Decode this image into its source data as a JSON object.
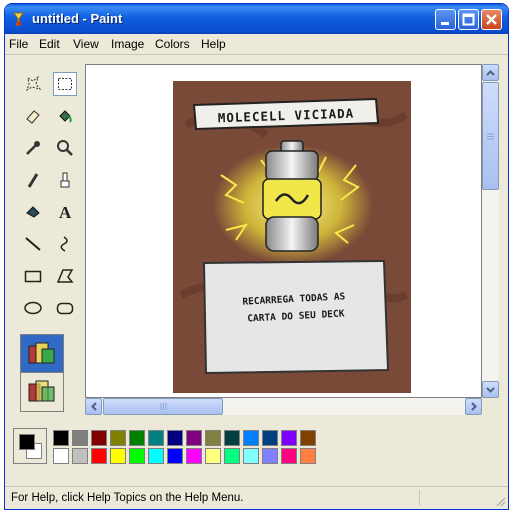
{
  "window": {
    "title": "untitled - Paint"
  },
  "menu": [
    "File",
    "Edit",
    "View",
    "Image",
    "Colors",
    "Help"
  ],
  "card": {
    "name": "MOLECELL VICIADA",
    "text_line1": "RECARREGA TODAS AS",
    "text_line2": "CARTA DO SEU DECK"
  },
  "palette": {
    "foreground": "#000000",
    "background": "#ffffff",
    "row1": [
      "#000000",
      "#808080",
      "#800000",
      "#808000",
      "#008000",
      "#008080",
      "#000080",
      "#800080",
      "#808040",
      "#004040",
      "#0080ff",
      "#004080",
      "#8000ff",
      "#804000"
    ],
    "row2": [
      "#ffffff",
      "#c0c0c0",
      "#ff0000",
      "#ffff00",
      "#00ff00",
      "#00ffff",
      "#0000ff",
      "#ff00ff",
      "#ffff80",
      "#00ff80",
      "#80ffff",
      "#8080ff",
      "#ff0080",
      "#ff8040"
    ]
  },
  "status": {
    "help_text": "For Help, click Help Topics on the Help Menu."
  },
  "colors": {
    "titlebar": "#0a4fd0",
    "card_bg": "#7a4a38",
    "glow": "#f3e23a"
  }
}
